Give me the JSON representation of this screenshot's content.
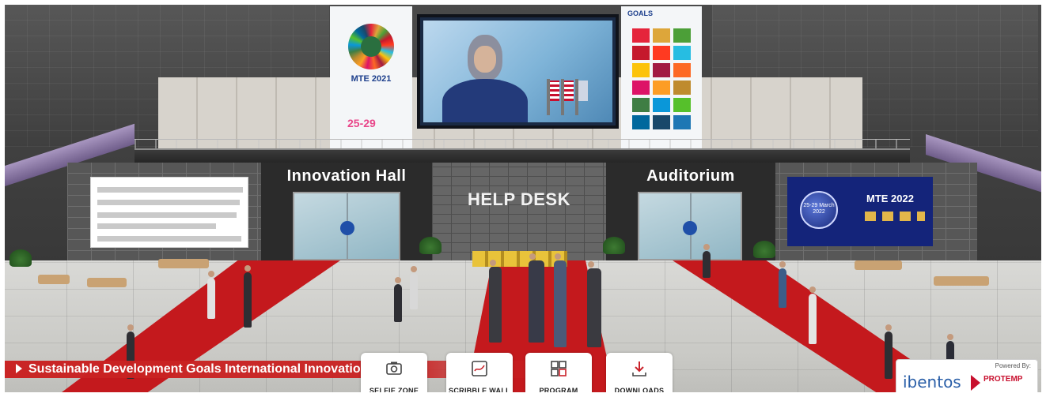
{
  "lobby": {
    "halls": {
      "innovation_label": "Innovation Hall",
      "auditorium_label": "Auditorium",
      "help_desk_label": "HELP DESK"
    },
    "banners": {
      "left_title": "MTE 2021",
      "left_dates": "25-29",
      "right_header": "GOALS"
    },
    "board_right": {
      "event": "MTE 2022",
      "globe_text": "25-29 March 2022"
    }
  },
  "award_bar": {
    "label": "Sustainable Development Goals International Innovation Award"
  },
  "menu": {
    "selfie": "SELFIE ZONE",
    "scribble": "SCRIBBLE WALL",
    "program": "PROGRAM",
    "downloads": "DOWNLOADS"
  },
  "powered": {
    "label": "Powered By:",
    "ibentos": "ibentos",
    "protemp": "PROTEMP"
  },
  "colors": {
    "accent_red": "#c9222",
    "door_dot": "#1f4fa8",
    "carpet": "#c4191d"
  },
  "icons": [
    "selfie-icon",
    "scribble-icon",
    "program-icon",
    "download-icon",
    "play-caret-icon"
  ]
}
